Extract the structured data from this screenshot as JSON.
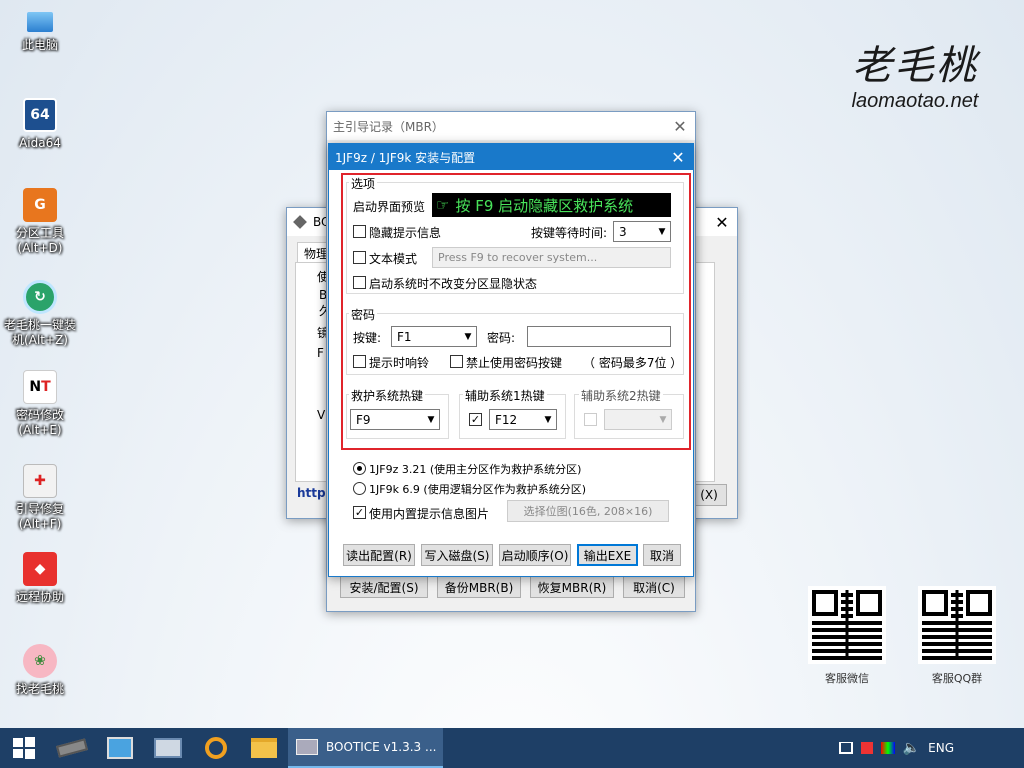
{
  "desktop": {
    "icons": [
      {
        "label": "此电脑"
      },
      {
        "label": "Aida64",
        "glyph": "64"
      },
      {
        "label": "分区工具\n(Alt+D)"
      },
      {
        "label": "老毛桃一键装\n机(Alt+Z)"
      },
      {
        "label": "密码修改\n(Alt+E)"
      },
      {
        "label": "引导修复\n(Alt+F)"
      },
      {
        "label": "远程协助"
      },
      {
        "label": "找老毛桃"
      }
    ],
    "logo": {
      "cn": "老毛桃",
      "en": "laomaotao.net"
    },
    "qr": [
      {
        "label": "客服微信"
      },
      {
        "label": "客服QQ群"
      }
    ]
  },
  "bg_window": {
    "title": "BOO",
    "tab_label": "物理",
    "frag_1": "使",
    "frag_2": "Bo",
    "frag_3": "久",
    "frag_4": "镜",
    "frag_5": "F",
    "frag_6": "VH",
    "link_text": "http:",
    "exit_button": "(X)"
  },
  "mbr_window": {
    "title": "主引导记录（MBR）",
    "buttons": {
      "install": "安装/配置(S)",
      "backup": "备份MBR(B)",
      "restore": "恢复MBR(R)",
      "cancel": "取消(C)"
    }
  },
  "config_dialog": {
    "title": "1JF9z / 1JF9k 安装与配置",
    "options_group": {
      "title": "选项",
      "preview_label": "启动界面预览",
      "preview_text": "按 F9 启动隐藏区救护系统",
      "hide_hint_label": "隐藏提示信息",
      "wait_label": "按键等待时间:",
      "wait_value": "3",
      "text_mode_label": "文本模式",
      "text_mode_placeholder": "Press F9 to recover system...",
      "keep_state_label": "启动系统时不改变分区显隐状态"
    },
    "password_group": {
      "title": "密码",
      "key_label": "按键:",
      "key_value": "F1",
      "pw_label": "密码:",
      "pw_value": "",
      "beep_label": "提示时响铃",
      "disable_key_label": "禁止使用密码按键",
      "max_note": "（ 密码最多7位 ）"
    },
    "hotkeys": {
      "rescue_title": "救护系统热键",
      "rescue_value": "F9",
      "aux1_title": "辅助系统1热键",
      "aux1_value": "F12",
      "aux2_title": "辅助系统2热键",
      "aux2_value": ""
    },
    "radio_1": "1JF9z 3.21 (使用主分区作为救护系统分区)",
    "radio_2": "1JF9k 6.9 (使用逻辑分区作为救护系统分区)",
    "builtin_image_label": "使用内置提示信息图片",
    "select_bitmap_button": "选择位图(16色, 208×16)",
    "buttons": {
      "read": "读出配置(R)",
      "write": "写入磁盘(S)",
      "boot_order": "启动顺序(O)",
      "export": "输出EXE",
      "cancel": "取消"
    }
  },
  "taskbar": {
    "active_label": "BOOTICE v1.3.3 ...",
    "lang": "ENG"
  },
  "colors": {
    "highlight_border": "#e0242b",
    "accent": "#0078d7",
    "preview_text": "#48e35a"
  }
}
